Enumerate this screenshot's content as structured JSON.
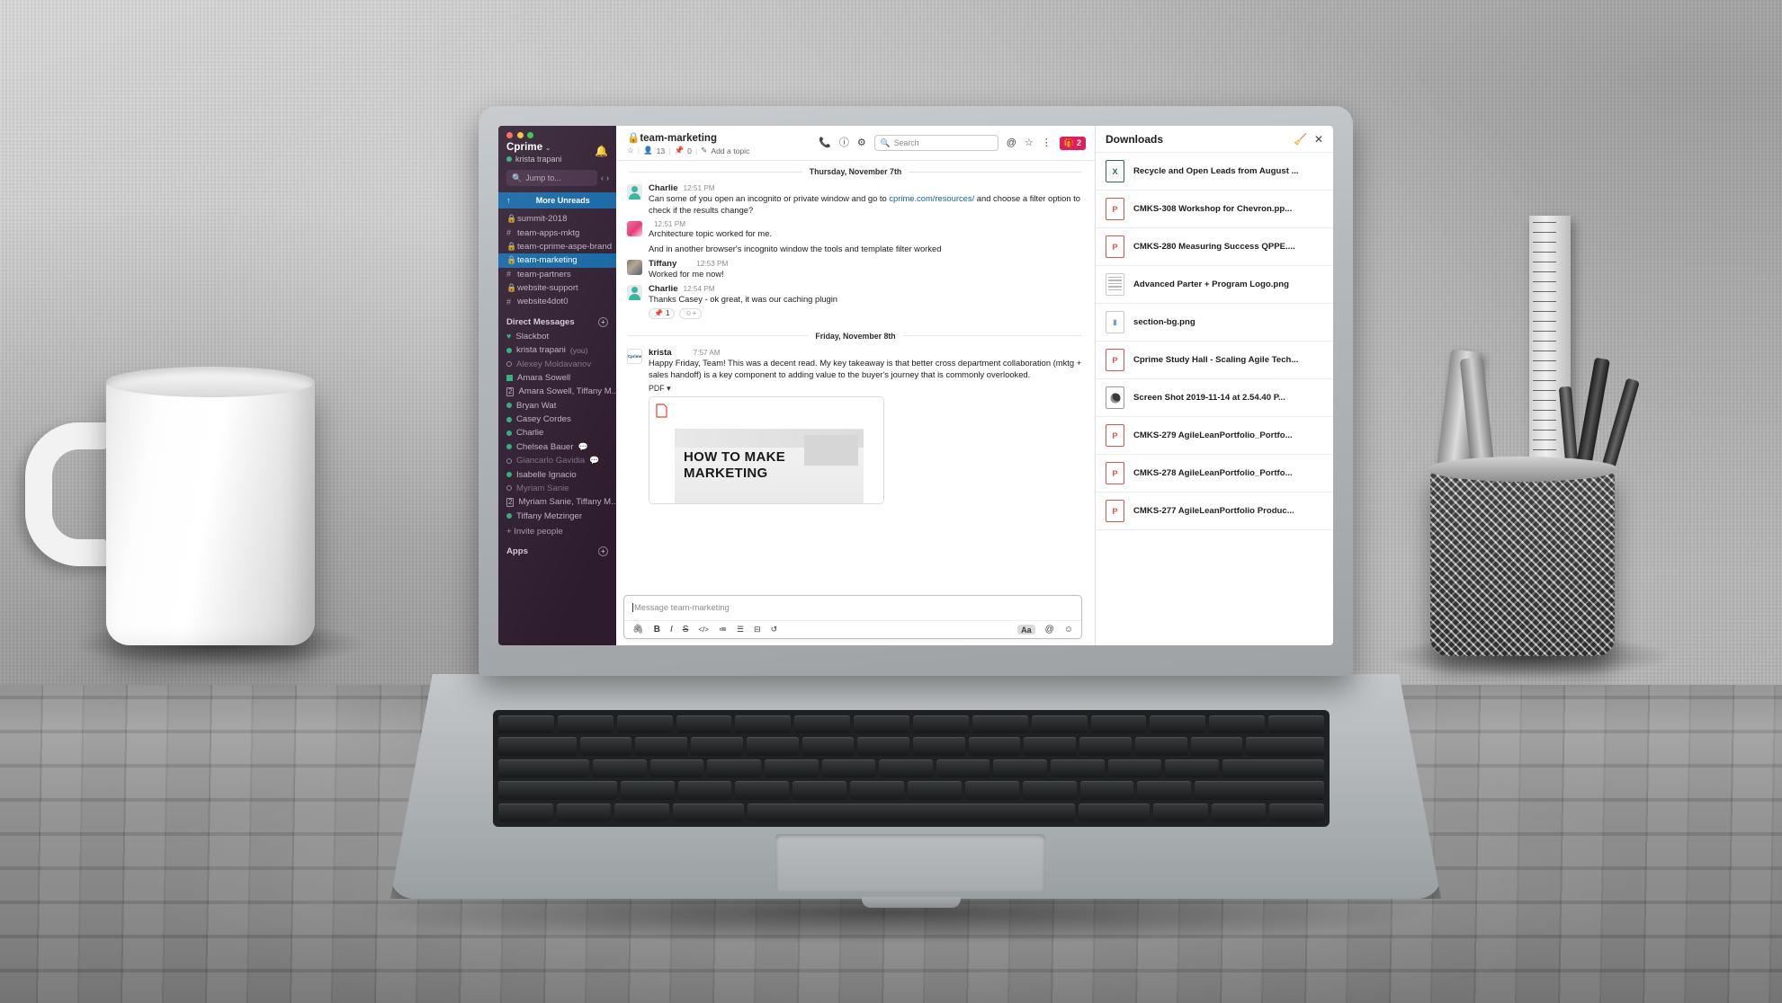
{
  "workspace": {
    "name": "Cprime",
    "chevron": "⌄",
    "user": "krista trapani",
    "bell_icon": "bell-icon"
  },
  "sidebar": {
    "jump": {
      "label": "Jump to...",
      "icon": "jump-to-icon",
      "back": "‹",
      "forward": "›"
    },
    "unreads": {
      "arrow": "↑",
      "label": "More Unreads"
    },
    "channels": [
      {
        "symbol": "lock",
        "name": "summit-2018",
        "active": false
      },
      {
        "symbol": "hash",
        "name": "team-apps-mktg",
        "active": false
      },
      {
        "symbol": "lock",
        "name": "team-cprime-aspe-brand",
        "active": false
      },
      {
        "symbol": "lock",
        "name": "team-marketing",
        "active": true
      },
      {
        "symbol": "hash",
        "name": "team-partners",
        "active": false
      },
      {
        "symbol": "lock",
        "name": "website-support",
        "active": false
      },
      {
        "symbol": "hash",
        "name": "website4dot0",
        "active": false
      }
    ],
    "dm_header": "Direct Messages",
    "dms": [
      {
        "name": "Slackbot",
        "presence": "heart",
        "muted": false,
        "you": "",
        "bubble": false
      },
      {
        "name": "krista trapani",
        "presence": "online",
        "muted": false,
        "you": "(you)",
        "bubble": false
      },
      {
        "name": "Alexey Moldavanov",
        "presence": "away",
        "muted": true,
        "you": "",
        "bubble": false
      },
      {
        "name": "Amara Sowell",
        "presence": "square",
        "muted": false,
        "you": "",
        "bubble": false
      },
      {
        "name": "Amara Sowell, Tiffany M...",
        "presence": "multi",
        "muted": false,
        "you": "",
        "bubble": false
      },
      {
        "name": "Bryan Wat",
        "presence": "online",
        "muted": false,
        "you": "",
        "bubble": false
      },
      {
        "name": "Casey Cordes",
        "presence": "online",
        "muted": false,
        "you": "",
        "bubble": false
      },
      {
        "name": "Charlie",
        "presence": "online",
        "muted": false,
        "you": "",
        "bubble": false
      },
      {
        "name": "Chelsea Bauer",
        "presence": "online",
        "muted": false,
        "you": "",
        "bubble": true
      },
      {
        "name": "Giancarlo Gavidia",
        "presence": "away",
        "muted": true,
        "you": "",
        "bubble": true
      },
      {
        "name": "Isabelle Ignacio",
        "presence": "online",
        "muted": false,
        "you": "",
        "bubble": false
      },
      {
        "name": "Myriam Sanie",
        "presence": "away",
        "muted": true,
        "you": "",
        "bubble": false
      },
      {
        "name": "Myriam Sanie, Tiffany M...",
        "presence": "multi",
        "muted": false,
        "you": "",
        "bubble": false
      },
      {
        "name": "Tiffany Metzinger",
        "presence": "online",
        "muted": false,
        "you": "",
        "bubble": false
      }
    ],
    "invite": "+  Invite people",
    "apps_header": "Apps"
  },
  "channel": {
    "title": "team-marketing",
    "lock_icon": "lock-icon",
    "star_icon": "star-icon",
    "members_icon": "members-icon",
    "members_count": "13",
    "pins_icon": "pin-icon",
    "pins_count": "0",
    "pencil_icon": "pencil-icon",
    "add_topic": "Add a topic",
    "actions": {
      "call": "phone-icon",
      "info": "info-icon",
      "settings": "gear-icon",
      "mentions": "at-icon",
      "stars": "star-icon",
      "more": "more-vertical-icon",
      "gift_icon": "gift-icon",
      "gift_count": "2"
    }
  },
  "search": {
    "placeholder": "Search",
    "icon": "search-icon"
  },
  "messages": {
    "day1": "Thursday, November 7th",
    "day2": "Friday, November 8th",
    "items": [
      {
        "author": "Charlie",
        "time": "12:51 PM",
        "avatar": "av-charlie",
        "text_before": "Can some of you open an incognito or private window and go to ",
        "link": "cprime.com/resources/",
        "text_after": " and choose a filter option to check if the results change?"
      },
      {
        "author": "",
        "time": "12:51 PM",
        "avatar": "av-casey",
        "line1": "Architecture topic worked for me.",
        "line2": "And in another browser's incognito window the tools and template filter worked"
      },
      {
        "author": "Tiffany",
        "time": "12:53 PM",
        "avatar": "av-tiffany",
        "text": "Worked for me now!"
      },
      {
        "author": "Charlie",
        "time": "12:54 PM",
        "avatar": "av-charlie",
        "text": "Thanks Casey - ok great, it was our caching plugin",
        "reaction_emoji": "📌",
        "reaction_count": "1",
        "add_reaction": "☺+"
      },
      {
        "author": "krista",
        "time": "7:57 AM",
        "avatar": "av-krista",
        "text": "Happy Friday, Team! This was a decent read. My key takeaway is that better cross department collaboration (mktg + sales handoff) is a key component to adding value to the buyer's journey that is commonly overlooked.",
        "file_type": "PDF",
        "file_chevron": "▾",
        "preview_line1": "HOW TO MAKE",
        "preview_line2": "MARKETING"
      }
    ]
  },
  "composer": {
    "placeholder": "Message team-marketing",
    "tools": [
      "attach-icon",
      "bold-icon",
      "italic-icon",
      "strikethrough-icon",
      "code-icon",
      "ordered-list-icon",
      "bulleted-list-icon",
      "blockquote-icon",
      "undo-icon"
    ],
    "tool_glyphs": [
      "🖇",
      "B",
      "I",
      "S",
      "</>",
      "☰",
      "☷",
      "⫶",
      "↺"
    ],
    "format_label": "Aa",
    "mention_icon": "at-icon",
    "emoji_icon": "emoji-icon"
  },
  "downloads": {
    "title": "Downloads",
    "clear_icon": "clear-downloads-icon",
    "close_icon": "close-icon",
    "items": [
      {
        "name": "Recycle and Open Leads from August ...",
        "type": "xls",
        "letter": "X"
      },
      {
        "name": "CMKS-308 Workshop for Chevron.pp...",
        "type": "ppt",
        "letter": "P"
      },
      {
        "name": "CMKS-280 Measuring Success QPPE....",
        "type": "ppt",
        "letter": "P"
      },
      {
        "name": "Advanced Parter + Program Logo.png",
        "type": "doc",
        "letter": ""
      },
      {
        "name": "section-bg.png",
        "type": "img",
        "letter": "▮"
      },
      {
        "name": "Cprime Study Hall - Scaling Agile Tech...",
        "type": "ppt",
        "letter": "P"
      },
      {
        "name": "Screen Shot 2019-11-14 at 2.54.40 P...",
        "type": "shot",
        "letter": ""
      },
      {
        "name": "CMKS-279 AgileLeanPortfolio_Portfo...",
        "type": "ppt",
        "letter": "P"
      },
      {
        "name": "CMKS-278 AgileLeanPortfolio_Portfo...",
        "type": "ppt",
        "letter": "P"
      },
      {
        "name": "CMKS-277 AgileLeanPortfolio Produc...",
        "type": "ppt",
        "letter": "P"
      }
    ]
  },
  "colors": {
    "sidebar_bg": "#2d1b2e",
    "active_item": "#1164a3",
    "link": "#1264a3",
    "badge_red": "#e01e5a",
    "presence_green": "#2bac76"
  }
}
